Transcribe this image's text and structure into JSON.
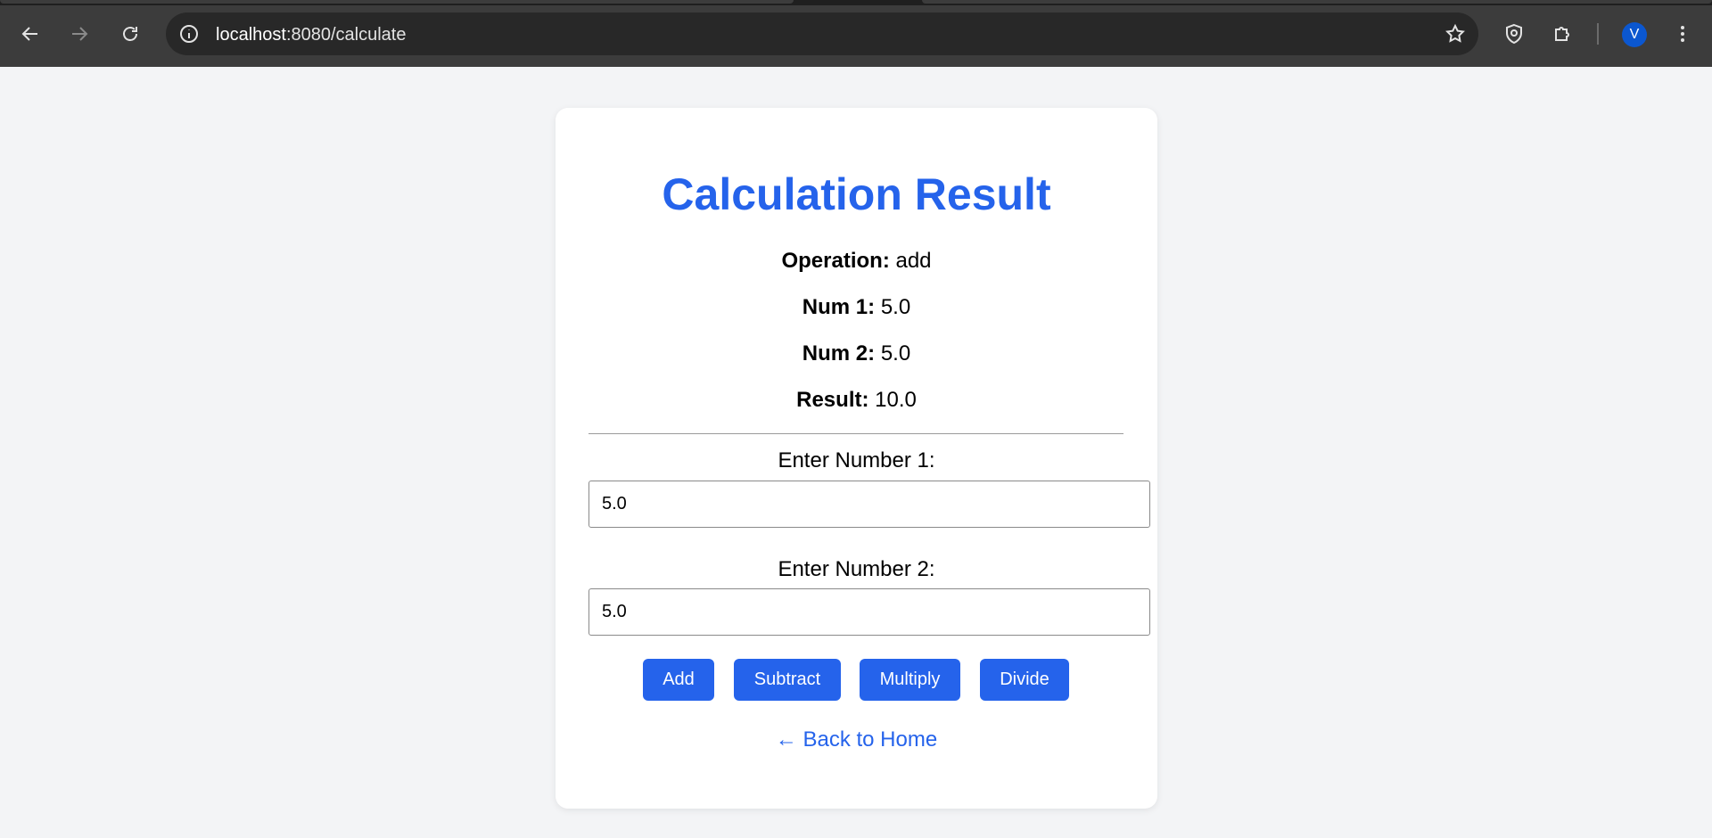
{
  "browser": {
    "url_host": "localhost",
    "url_path": ":8080/calculate",
    "avatar_letter": "V"
  },
  "page": {
    "title": "Calculation Result",
    "operation_label": "Operation:",
    "operation_value": "add",
    "num1_label": "Num 1:",
    "num1_value": "5.0",
    "num2_label": "Num 2:",
    "num2_value": "5.0",
    "result_label": "Result:",
    "result_value": "10.0",
    "field1_label": "Enter Number 1:",
    "field1_value": "5.0",
    "field2_label": "Enter Number 2:",
    "field2_value": "5.0",
    "buttons": {
      "add": "Add",
      "subtract": "Subtract",
      "multiply": "Multiply",
      "divide": "Divide"
    },
    "back_link": "← Back to Home"
  },
  "colors": {
    "accent": "#2563eb",
    "page_background": "#f3f4f6",
    "card_background": "#ffffff",
    "chrome_toolbar": "#3c3c3c",
    "omnibox": "#282828"
  }
}
